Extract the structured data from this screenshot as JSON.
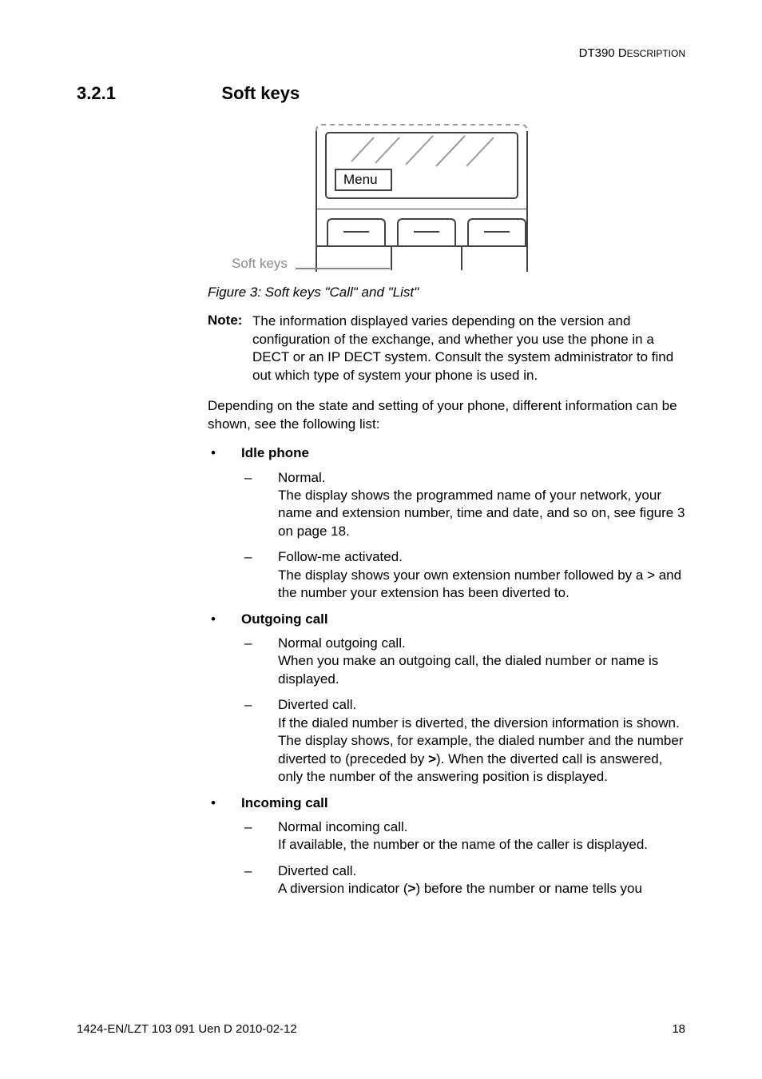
{
  "header": {
    "text": "DT390 Description"
  },
  "section": {
    "number": "3.2.1",
    "title": "Soft keys"
  },
  "figure": {
    "softkeys_label": "Soft keys",
    "menu_label": "Menu",
    "caption": "Figure 3:  Soft keys \"Call\" and \"List\""
  },
  "note": {
    "label": "Note:",
    "body": "The information displayed varies depending on the version and configuration of the exchange, and whether you use the phone in a DECT or an IP DECT system. Consult the system administrator to find out which type of system your phone is used in."
  },
  "intro": "Depending on the state and setting of your phone, different information can be shown, see the following list:",
  "lists": {
    "idle": {
      "head": "Idle phone",
      "items": [
        {
          "title": "Normal.",
          "body": "The display shows the programmed name of your network, your name and extension number, time and date, and so on, see figure 3 on page 18."
        },
        {
          "title": "Follow-me activated.",
          "body": "The display shows your own extension number followed by a > and the number your extension has been diverted to."
        }
      ]
    },
    "outgoing": {
      "head": "Outgoing call",
      "items": [
        {
          "title": "Normal outgoing call.",
          "body": "When you make an outgoing call, the dialed number or name is displayed."
        },
        {
          "title": "Diverted call.",
          "body_pre": "If the dialed number is diverted, the diversion information is shown. The display shows, for example, the dialed number and the number diverted to (preceded by ",
          "bold": ">",
          "body_post": "). When the diverted call is answered, only the number of the answering position is displayed."
        }
      ]
    },
    "incoming": {
      "head": "Incoming call",
      "items": [
        {
          "title": "Normal incoming call.",
          "body": "If available, the number or the name of the caller is displayed."
        },
        {
          "title": "Diverted call.",
          "body_pre": "A diversion indicator (",
          "bold": ">",
          "body_post": ") before the number or name tells you"
        }
      ]
    }
  },
  "footer": {
    "left": "1424-EN/LZT 103 091 Uen D 2010-02-12",
    "page": "18"
  }
}
